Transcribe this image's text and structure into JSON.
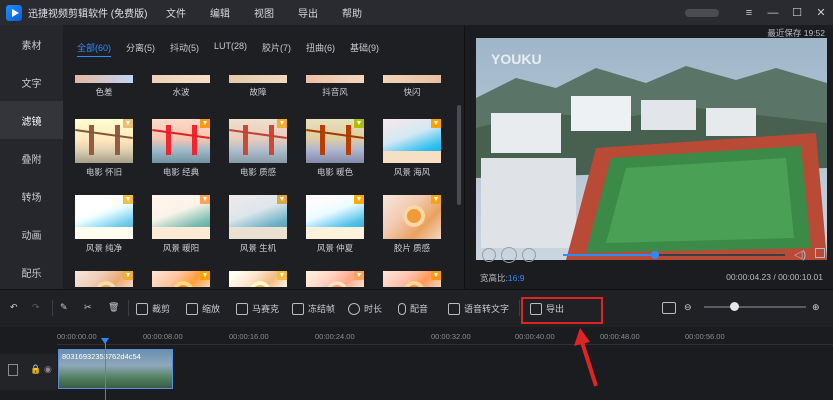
{
  "titlebar": {
    "title": "迅捷视频剪辑软件 (免费版)",
    "menu": [
      "文件",
      "编辑",
      "视图",
      "导出",
      "帮助"
    ]
  },
  "left_tabs": [
    "素材",
    "文字",
    "滤镜",
    "叠附",
    "转场",
    "动画",
    "配乐"
  ],
  "active_left_tab": "滤镜",
  "library": {
    "categories": [
      "全部(60)",
      "分离(5)",
      "抖动(5)",
      "LUT(28)",
      "胶片(7)",
      "扭曲(6)",
      "基础(9)"
    ],
    "active_category": "全部(60)",
    "row0_labels": [
      "色差",
      "水波",
      "故障",
      "抖音风",
      "快闪"
    ],
    "row1_labels": [
      "电影 怀旧",
      "电影 经典",
      "电影 质感",
      "电影 暖色",
      "风景 海风"
    ],
    "row2_labels": [
      "风景 纯净",
      "风景 暖阳",
      "风景 生机",
      "风景 仲夏",
      "胶片 质感"
    ]
  },
  "preview": {
    "last_saved": "最近保存 19:52",
    "aspect_label": "宽高比:",
    "aspect_value": "16:9",
    "time": "00:00:04.23 / 00:00:10.01",
    "watermark": "YOUKU",
    "progress": 0.42
  },
  "toolbar": {
    "crop": "裁剪",
    "zoom": "缩放",
    "mosaic": "马赛克",
    "freeze": "冻结帧",
    "duration": "时长",
    "dub": "配音",
    "speech_to_text": "语音转文字",
    "export": "导出"
  },
  "timeline": {
    "ticks": [
      "00:00:00.00",
      "00:00:08.00",
      "00:00:16.00",
      "00:00:24.00",
      "00:00:32.00",
      "00:00:40.00",
      "00:00:48.00",
      "00:00:56.00"
    ],
    "clip_label": "80316932353762d4c54"
  },
  "colors": {
    "accent": "#2e8bff",
    "highlight": "#e02424"
  }
}
